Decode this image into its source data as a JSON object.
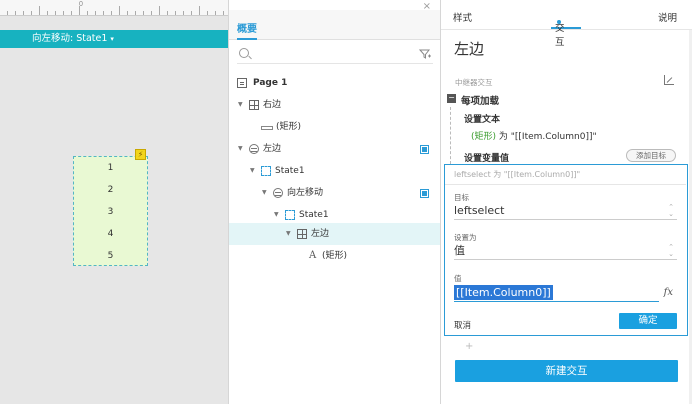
{
  "canvas": {
    "ruler_zero": "0",
    "state_bar": {
      "label": "向左移动: State1",
      "caret": "▾"
    },
    "widget_rows": [
      "1",
      "2",
      "3",
      "4",
      "5"
    ],
    "event_badge": "⚡"
  },
  "outline": {
    "close": "×",
    "tab": "概要",
    "tree": [
      {
        "label": "Page 1",
        "icon": "page-icon",
        "bold": true
      },
      {
        "label": "右边",
        "icon": "repeater-icon"
      },
      {
        "label": "(矩形)",
        "icon": "rectangle-icon"
      },
      {
        "label": "左边",
        "icon": "dynamic-panel-icon",
        "badge": true
      },
      {
        "label": "State1",
        "icon": "state-icon"
      },
      {
        "label": "向左移动",
        "icon": "dynamic-panel-icon",
        "badge": true
      },
      {
        "label": "State1",
        "icon": "state-icon"
      },
      {
        "label": "左边",
        "icon": "repeater-icon",
        "selected": true
      },
      {
        "label": "(矩形)",
        "icon": "text-icon",
        "glyph": "A"
      }
    ]
  },
  "panel": {
    "tabs": {
      "style": "样式",
      "interaction": "交互",
      "notes": "说明"
    },
    "title": "左边",
    "section_label": "中继器交互",
    "event": {
      "toggle": "−",
      "name": "每项加载"
    },
    "action1": {
      "name": "设置文本",
      "target": "(矩形)",
      "detail": " 为 \"[[Item.Column0]]\""
    },
    "action2": {
      "name": "设置变量值",
      "add_target": "添加目标"
    },
    "editor": {
      "summary": "leftselect 为 \"[[Item.Column0]]\"",
      "target_label": "目标",
      "target_value": "leftselect",
      "set_as_label": "设置为",
      "set_as_value": "值",
      "value_label": "值",
      "value_text": "[[Item.Column0]]",
      "fx": "fx",
      "cancel": "取消",
      "ok": "确定"
    },
    "plus": "+",
    "new_interaction": "新建交互"
  }
}
